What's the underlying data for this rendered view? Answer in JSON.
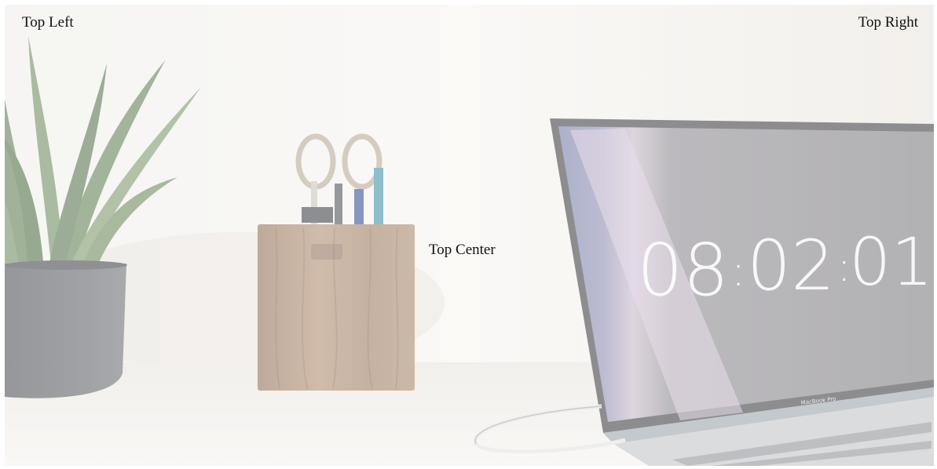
{
  "captions": {
    "top_left": "Top Left",
    "top_right": "Top Right",
    "top_center": "Top Center"
  },
  "photo": {
    "laptop_clock": {
      "hours": "08",
      "minutes": "02",
      "seconds": "01",
      "separator": ":"
    },
    "laptop_brand": "MacBook Pro"
  },
  "colors": {
    "wall": "#f1efea",
    "desk": "#f4f2ee",
    "pot": "#55575c",
    "leaf": "#6f8a5f",
    "wood": "#a58467",
    "screen": "#7c7b80",
    "caption_text": "#111111"
  },
  "icons": {
    "plant": "potted-plant",
    "pen_holder": "wooden-pen-holder",
    "laptop": "laptop"
  }
}
